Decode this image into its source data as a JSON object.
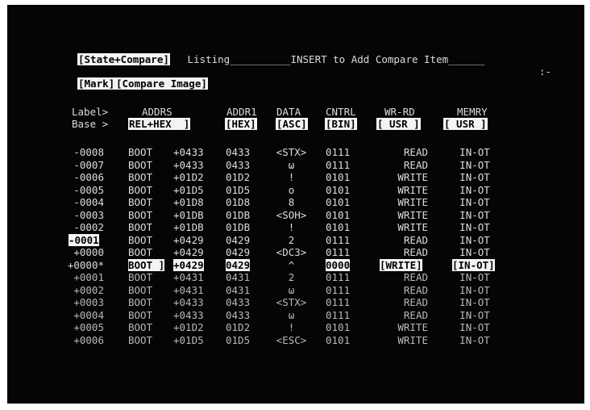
{
  "header": {
    "state_compare_label": "[State+Compare]",
    "listing_text": " Listing__________INSERT to Add Compare Item______",
    "cursor_symbol": ":-",
    "mark_label": "[Mark]",
    "compare_image_label": "[Compare Image]"
  },
  "columns": {
    "label_title": "Label>",
    "base_title": "Base >",
    "addrs_title": "ADDRS",
    "addrs_base": "REL+HEX  ]",
    "addr1_title": "ADDR1",
    "addr1_base": "[HEX]",
    "data_title": "DATA",
    "data_base": "[ASC]",
    "cntrl_title": "CNTRL",
    "cntrl_base": "[BIN]",
    "wrrd_title": "WR-RD",
    "wrrd_base": "[ USR ]",
    "memry_title": "MEMRY",
    "memry_base": "[ USR ]"
  },
  "rows": [
    {
      "state": "-0008",
      "sym": "BOOT",
      "off": "+0433",
      "addr1": "0433",
      "data": "<STX>",
      "cntrl": "0111",
      "wrrd": "READ",
      "memry": "IN-OT"
    },
    {
      "state": "-0007",
      "sym": "BOOT",
      "off": "+0433",
      "addr1": "0433",
      "data": "ω",
      "cntrl": "0111",
      "wrrd": "READ",
      "memry": "IN-OT"
    },
    {
      "state": "-0006",
      "sym": "BOOT",
      "off": "+01D2",
      "addr1": "01D2",
      "data": "!",
      "cntrl": "0101",
      "wrrd": "WRITE",
      "memry": "IN-OT"
    },
    {
      "state": "-0005",
      "sym": "BOOT",
      "off": "+01D5",
      "addr1": "01D5",
      "data": "o",
      "cntrl": "0101",
      "wrrd": "WRITE",
      "memry": "IN-OT"
    },
    {
      "state": "-0004",
      "sym": "BOOT",
      "off": "+01D8",
      "addr1": "01D8",
      "data": "8",
      "cntrl": "0101",
      "wrrd": "WRITE",
      "memry": "IN-OT"
    },
    {
      "state": "-0003",
      "sym": "BOOT",
      "off": "+01DB",
      "addr1": "01DB",
      "data": "<SOH>",
      "cntrl": "0101",
      "wrrd": "WRITE",
      "memry": "IN-OT"
    },
    {
      "state": "-0002",
      "sym": "BOOT",
      "off": "+01DB",
      "addr1": "01DB",
      "data": "!",
      "cntrl": "0101",
      "wrrd": "WRITE",
      "memry": "IN-OT"
    },
    {
      "state": "-0001",
      "sym": "BOOT",
      "off": "+0429",
      "addr1": "0429",
      "data": "2",
      "cntrl": "0111",
      "wrrd": "READ",
      "memry": "IN-OT"
    },
    {
      "state": "+0000",
      "sym": "BOOT",
      "off": "+0429",
      "addr1": "0429",
      "data": "<DC3>",
      "cntrl": "0111",
      "wrrd": "READ",
      "memry": "IN-OT"
    },
    {
      "state": "+0000*",
      "sym": "BOOT ]",
      "off": "+0429",
      "addr1": "0429",
      "data": "^",
      "cntrl": "0000",
      "wrrd": "[WRITE]",
      "memry": "[IN-OT]"
    },
    {
      "state": "+0001",
      "sym": "BOOT",
      "off": "+0431",
      "addr1": "0431",
      "data": "2",
      "cntrl": "0111",
      "wrrd": "READ",
      "memry": "IN-OT"
    },
    {
      "state": "+0002",
      "sym": "BOOT",
      "off": "+0431",
      "addr1": "0431",
      "data": "ω",
      "cntrl": "0111",
      "wrrd": "READ",
      "memry": "IN-OT"
    },
    {
      "state": "+0003",
      "sym": "BOOT",
      "off": "+0433",
      "addr1": "0433",
      "data": "<STX>",
      "cntrl": "0111",
      "wrrd": "READ",
      "memry": "IN-OT"
    },
    {
      "state": "+0004",
      "sym": "BOOT",
      "off": "+0433",
      "addr1": "0433",
      "data": "ω",
      "cntrl": "0111",
      "wrrd": "READ",
      "memry": "IN-OT"
    },
    {
      "state": "+0005",
      "sym": "BOOT",
      "off": "+01D2",
      "addr1": "01D2",
      "data": "!",
      "cntrl": "0101",
      "wrrd": "WRITE",
      "memry": "IN-OT"
    },
    {
      "state": "+0006",
      "sym": "BOOT",
      "off": "+01D5",
      "addr1": "01D5",
      "data": "<ESC>",
      "cntrl": "0101",
      "wrrd": "WRITE",
      "memry": "IN-OT"
    }
  ]
}
